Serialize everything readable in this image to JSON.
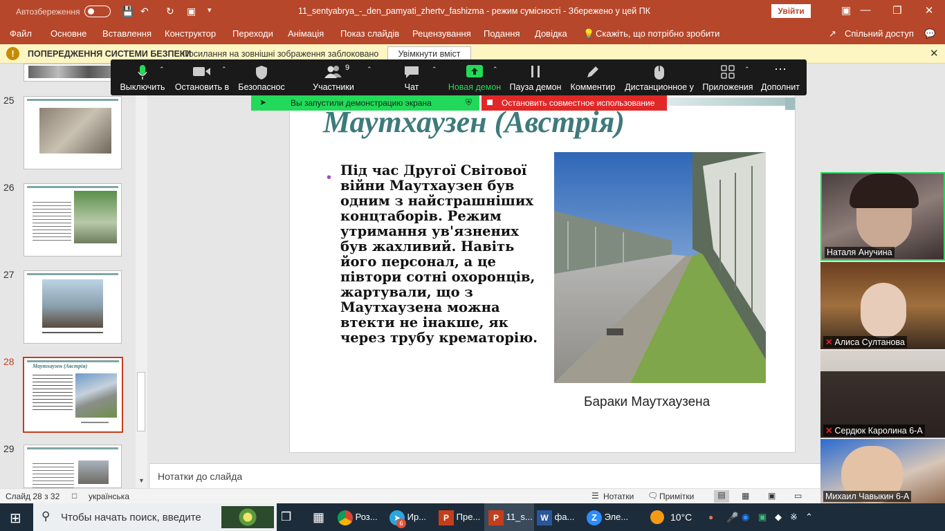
{
  "titlebar": {
    "autosave": "Автозбереження",
    "doc_title": "11_sentyabrya_-_den_pamyati_zhertv_fashizma  -  режим сумісності  -  Збережено у цей ПК",
    "signin": "Увійти",
    "minimize": "—",
    "restore": "❐",
    "close": "✕",
    "save_icon": "save-icon",
    "undo_icon": "undo-icon",
    "redo_icon": "redo-icon"
  },
  "ribbon": {
    "tabs": [
      "Файл",
      "Основне",
      "Вставлення",
      "Конструктор",
      "Переходи",
      "Анімація",
      "Показ слайдів",
      "Рецензування",
      "Подання",
      "Довідка"
    ],
    "tell_me": "Скажіть, що потрібно зробити",
    "share": "Спільний доступ"
  },
  "security": {
    "title": "ПОПЕРЕДЖЕННЯ СИСТЕМИ БЕЗПЕКИ",
    "message": "Посилання на зовнішні зображення заблоковано",
    "enable": "Увімкнути вміст",
    "icon": "!",
    "close": "✕"
  },
  "thumbnails": [
    {
      "num": "25"
    },
    {
      "num": "26"
    },
    {
      "num": "27"
    },
    {
      "num": "28"
    },
    {
      "num": "29"
    }
  ],
  "slide": {
    "title": "Маутхаузен (Австрія)",
    "bullet": "•",
    "body": "Під час Другої Світової війни Маутхаузен був одним з найстрашніших концтаборів. Режим утримання ув'язнених був жахливий. Навіть його персонал, а це півтори сотні охоронців, жартували, що з Маутхаузена можна втекти не інакше, як через трубу крематорію.",
    "caption": "Бараки Маутхаузена"
  },
  "notes": {
    "placeholder": "Нотатки до слайда"
  },
  "status": {
    "slide": "Слайд 28 з 32",
    "language": "українська",
    "notes": "Нотатки",
    "comments": "Примітки"
  },
  "zoom": {
    "items": [
      {
        "label": "Выключить",
        "icon": "microphone-icon"
      },
      {
        "label": "Остановить в",
        "icon": "video-camera-icon"
      },
      {
        "label": "Безопаснос",
        "icon": "shield-icon"
      },
      {
        "label": "Участники",
        "icon": "participants-icon",
        "count": "9"
      },
      {
        "label": "Чат",
        "icon": "chat-icon"
      },
      {
        "label": "Новая демон",
        "icon": "share-screen-icon"
      },
      {
        "label": "Пауза демон",
        "icon": "pause-icon"
      },
      {
        "label": "Комментир",
        "icon": "annotate-icon"
      },
      {
        "label": "Дистанционное у",
        "icon": "remote-control-icon"
      },
      {
        "label": "Приложения",
        "icon": "apps-icon"
      },
      {
        "label": "Дополнит",
        "icon": "more-icon"
      }
    ],
    "share_banner": "Вы запустили демонстрацию экрана",
    "stop_share": "Остановить совместное использование"
  },
  "participants": [
    {
      "name": "Наталя Анучина",
      "muted": false
    },
    {
      "name": "Алиса Султанова",
      "muted": true
    },
    {
      "name": "Сердюк Каролина 6-А",
      "muted": true
    },
    {
      "name": "Михаил Чавыкин 6-А",
      "muted": false
    }
  ],
  "taskbar": {
    "search": "Чтобы начать поиск, введите",
    "apps": [
      {
        "label": "Роз...",
        "icon": "chrome-icon"
      },
      {
        "label": "Ир...",
        "icon": "telegram-icon",
        "badge": "6"
      },
      {
        "label": "Пре...",
        "icon": "powerpoint-icon"
      },
      {
        "label": "11_s...",
        "icon": "powerpoint-icon"
      },
      {
        "label": "фа...",
        "icon": "word-icon"
      },
      {
        "label": "Эле...",
        "icon": "zoom-icon"
      }
    ],
    "weather": "10°C",
    "colors": {
      "taskbar": "#1c2c3b",
      "brand": "#b7472a",
      "share_green": "#23d959",
      "stop_red": "#e02828"
    }
  }
}
